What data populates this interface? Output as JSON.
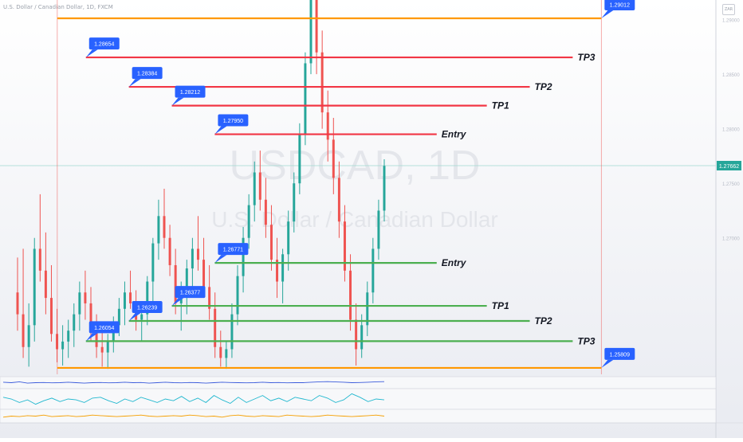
{
  "header": {
    "title": "U.S. Dollar / Canadian Dollar, 1D, FXCM"
  },
  "corner_button": {
    "label": "ZAR"
  },
  "chart_data": {
    "type": "candlestick",
    "symbol": "USDCAD, 1D",
    "description": "U.S. Dollar / Canadian Dollar",
    "ylim": [
      1.2575,
      1.2918
    ],
    "last_price": 1.27662,
    "colors": {
      "up": "#26a69a",
      "down": "#ef5350",
      "short": "#f23645",
      "long": "#4caf50",
      "range": "#ff9800",
      "label_bg": "#2962ff",
      "price_tag": "#26a69a"
    },
    "yaxis_ticks": [
      "1.29000",
      "1.28500",
      "1.28000",
      "1.27500",
      "1.27000"
    ],
    "candles": [
      [
        1.265,
        1.2682,
        1.2615,
        1.263
      ],
      [
        1.263,
        1.269,
        1.259,
        1.26
      ],
      [
        1.26,
        1.264,
        1.2582,
        1.262
      ],
      [
        1.262,
        1.27,
        1.2605,
        1.269
      ],
      [
        1.269,
        1.274,
        1.266,
        1.267
      ],
      [
        1.267,
        1.2705,
        1.263,
        1.2645
      ],
      [
        1.2645,
        1.2675,
        1.2605,
        1.2612
      ],
      [
        1.2612,
        1.2635,
        1.2586,
        1.2598
      ],
      [
        1.2598,
        1.262,
        1.2583,
        1.2605
      ],
      [
        1.2605,
        1.2625,
        1.259,
        1.2615
      ],
      [
        1.2615,
        1.264,
        1.26,
        1.263
      ],
      [
        1.263,
        1.266,
        1.2615,
        1.265
      ],
      [
        1.265,
        1.267,
        1.2625,
        1.264
      ],
      [
        1.264,
        1.2655,
        1.2605,
        1.2615
      ],
      [
        1.2615,
        1.263,
        1.259,
        1.26
      ],
      [
        1.26,
        1.2618,
        1.2582,
        1.2595
      ],
      [
        1.2595,
        1.2612,
        1.258,
        1.2605
      ],
      [
        1.2605,
        1.2628,
        1.2595,
        1.262
      ],
      [
        1.262,
        1.2645,
        1.261,
        1.2635
      ],
      [
        1.2635,
        1.266,
        1.262,
        1.265
      ],
      [
        1.265,
        1.267,
        1.2635,
        1.264
      ],
      [
        1.264,
        1.2652,
        1.2615,
        1.2625
      ],
      [
        1.2625,
        1.264,
        1.2605,
        1.263
      ],
      [
        1.263,
        1.2665,
        1.262,
        1.266
      ],
      [
        1.266,
        1.27,
        1.264,
        1.2695
      ],
      [
        1.2695,
        1.2735,
        1.268,
        1.272
      ],
      [
        1.272,
        1.2745,
        1.269,
        1.27
      ],
      [
        1.27,
        1.2712,
        1.2665,
        1.2675
      ],
      [
        1.2675,
        1.269,
        1.263,
        1.264
      ],
      [
        1.264,
        1.266,
        1.2615,
        1.265
      ],
      [
        1.265,
        1.268,
        1.263,
        1.2672
      ],
      [
        1.2672,
        1.27,
        1.265,
        1.269
      ],
      [
        1.269,
        1.272,
        1.267,
        1.268
      ],
      [
        1.268,
        1.27,
        1.2645,
        1.2655
      ],
      [
        1.2655,
        1.2675,
        1.2625,
        1.2635
      ],
      [
        1.2635,
        1.265,
        1.259,
        1.26
      ],
      [
        1.26,
        1.2615,
        1.2582,
        1.259
      ],
      [
        1.259,
        1.2605,
        1.258,
        1.2598
      ],
      [
        1.2598,
        1.264,
        1.259,
        1.263
      ],
      [
        1.263,
        1.2675,
        1.262,
        1.2665
      ],
      [
        1.2665,
        1.271,
        1.265,
        1.27
      ],
      [
        1.27,
        1.274,
        1.269,
        1.273
      ],
      [
        1.273,
        1.277,
        1.2715,
        1.276
      ],
      [
        1.276,
        1.278,
        1.2725,
        1.2735
      ],
      [
        1.2735,
        1.2755,
        1.27,
        1.2712
      ],
      [
        1.2712,
        1.273,
        1.267,
        1.268
      ],
      [
        1.268,
        1.27,
        1.2645,
        1.266
      ],
      [
        1.266,
        1.269,
        1.264,
        1.2685
      ],
      [
        1.2685,
        1.2725,
        1.267,
        1.2715
      ],
      [
        1.2715,
        1.276,
        1.2705,
        1.275
      ],
      [
        1.275,
        1.2805,
        1.274,
        1.2795
      ],
      [
        1.2795,
        1.287,
        1.2785,
        1.286
      ],
      [
        1.286,
        1.295,
        1.285,
        1.2935
      ],
      [
        1.2935,
        1.2945,
        1.285,
        1.287
      ],
      [
        1.287,
        1.289,
        1.28,
        1.2815
      ],
      [
        1.2815,
        1.2835,
        1.277,
        1.279
      ],
      [
        1.279,
        1.281,
        1.274,
        1.2755
      ],
      [
        1.2755,
        1.277,
        1.27,
        1.2715
      ],
      [
        1.2715,
        1.273,
        1.266,
        1.267
      ],
      [
        1.267,
        1.2685,
        1.2615,
        1.2625
      ],
      [
        1.2625,
        1.264,
        1.2583,
        1.2598
      ],
      [
        1.2598,
        1.263,
        1.259,
        1.262
      ],
      [
        1.262,
        1.266,
        1.261,
        1.265
      ],
      [
        1.265,
        1.27,
        1.264,
        1.269
      ],
      [
        1.269,
        1.2735,
        1.268,
        1.2725
      ],
      [
        1.2725,
        1.2772,
        1.2715,
        1.2766
      ]
    ],
    "lines": [
      {
        "kind": "range",
        "x_start": 0.08,
        "x_end": 0.84,
        "price": 1.29012
      },
      {
        "kind": "short",
        "x_start": 0.12,
        "x_end": 0.8,
        "price": 1.28654,
        "label": "TP3"
      },
      {
        "kind": "short",
        "x_start": 0.18,
        "x_end": 0.74,
        "price": 1.28384,
        "label": "TP2"
      },
      {
        "kind": "short",
        "x_start": 0.24,
        "x_end": 0.68,
        "price": 1.28212,
        "label": "TP1"
      },
      {
        "kind": "short",
        "x_start": 0.3,
        "x_end": 0.61,
        "price": 1.2795,
        "label": "Entry"
      },
      {
        "kind": "long",
        "x_start": 0.3,
        "x_end": 0.61,
        "price": 1.26771,
        "label": "Entry"
      },
      {
        "kind": "long",
        "x_start": 0.24,
        "x_end": 0.68,
        "price": 1.26377,
        "label": "TP1"
      },
      {
        "kind": "long",
        "x_start": 0.18,
        "x_end": 0.74,
        "price": 1.26239,
        "label": "TP2"
      },
      {
        "kind": "long",
        "x_start": 0.12,
        "x_end": 0.8,
        "price": 1.26054,
        "label": "TP3"
      },
      {
        "kind": "range",
        "x_start": 0.08,
        "x_end": 0.84,
        "price": 1.25809
      }
    ],
    "tags": [
      {
        "text": "1.29012",
        "x": 0.84,
        "price": 1.29012
      },
      {
        "text": "1.28654",
        "x": 0.12,
        "price": 1.28654
      },
      {
        "text": "1.28384",
        "x": 0.18,
        "price": 1.28384
      },
      {
        "text": "1.28212",
        "x": 0.24,
        "price": 1.28212
      },
      {
        "text": "1.27950",
        "x": 0.3,
        "price": 1.2795
      },
      {
        "text": "1.26771",
        "x": 0.3,
        "price": 1.26771
      },
      {
        "text": "1.26377",
        "x": 0.24,
        "price": 1.26377
      },
      {
        "text": "1.26239",
        "x": 0.18,
        "price": 1.26239
      },
      {
        "text": "1.26054",
        "x": 0.12,
        "price": 1.26054
      },
      {
        "text": "1.25809",
        "x": 0.84,
        "price": 1.25809
      }
    ],
    "vlines": [
      {
        "x": 0.08,
        "color": "#ef5350"
      },
      {
        "x": 0.84,
        "color": "#ef5350"
      }
    ],
    "indicators": [
      {
        "name": "blue",
        "color": "#3b5bdb",
        "values": [
          0.55,
          0.5,
          0.6,
          0.45,
          0.5,
          0.52,
          0.48,
          0.5,
          0.55,
          0.5,
          0.45,
          0.5,
          0.52,
          0.48,
          0.5,
          0.55,
          0.5,
          0.52,
          0.45,
          0.5,
          0.55,
          0.5,
          0.48,
          0.52,
          0.5,
          0.45,
          0.5,
          0.55,
          0.52,
          0.5,
          0.48,
          0.5,
          0.55,
          0.5,
          0.52,
          0.48,
          0.5,
          0.5,
          0.55,
          0.6,
          0.62,
          0.58,
          0.55,
          0.5,
          0.52,
          0.55,
          0.6,
          0.62
        ]
      },
      {
        "name": "cyan",
        "color": "#22b8cf",
        "values": [
          0.6,
          0.5,
          0.3,
          0.45,
          0.2,
          0.4,
          0.55,
          0.35,
          0.5,
          0.45,
          0.3,
          0.55,
          0.6,
          0.4,
          0.25,
          0.5,
          0.35,
          0.6,
          0.45,
          0.3,
          0.5,
          0.4,
          0.65,
          0.35,
          0.55,
          0.3,
          0.7,
          0.45,
          0.25,
          0.6,
          0.3,
          0.5,
          0.7,
          0.4,
          0.55,
          0.35,
          0.6,
          0.5,
          0.4,
          0.7,
          0.55,
          0.3,
          0.45,
          0.8,
          0.6,
          0.35,
          0.5,
          0.45
        ]
      },
      {
        "name": "orange",
        "color": "#f59f00",
        "values": [
          0.4,
          0.5,
          0.45,
          0.55,
          0.5,
          0.6,
          0.45,
          0.5,
          0.55,
          0.45,
          0.5,
          0.6,
          0.55,
          0.5,
          0.45,
          0.5,
          0.55,
          0.6,
          0.5,
          0.45,
          0.5,
          0.55,
          0.5,
          0.6,
          0.55,
          0.45,
          0.5,
          0.4,
          0.55,
          0.6,
          0.5,
          0.45,
          0.55,
          0.5,
          0.45,
          0.6,
          0.55,
          0.5,
          0.45,
          0.5,
          0.6,
          0.55,
          0.5,
          0.45,
          0.5,
          0.55,
          0.6,
          0.5
        ]
      }
    ]
  }
}
